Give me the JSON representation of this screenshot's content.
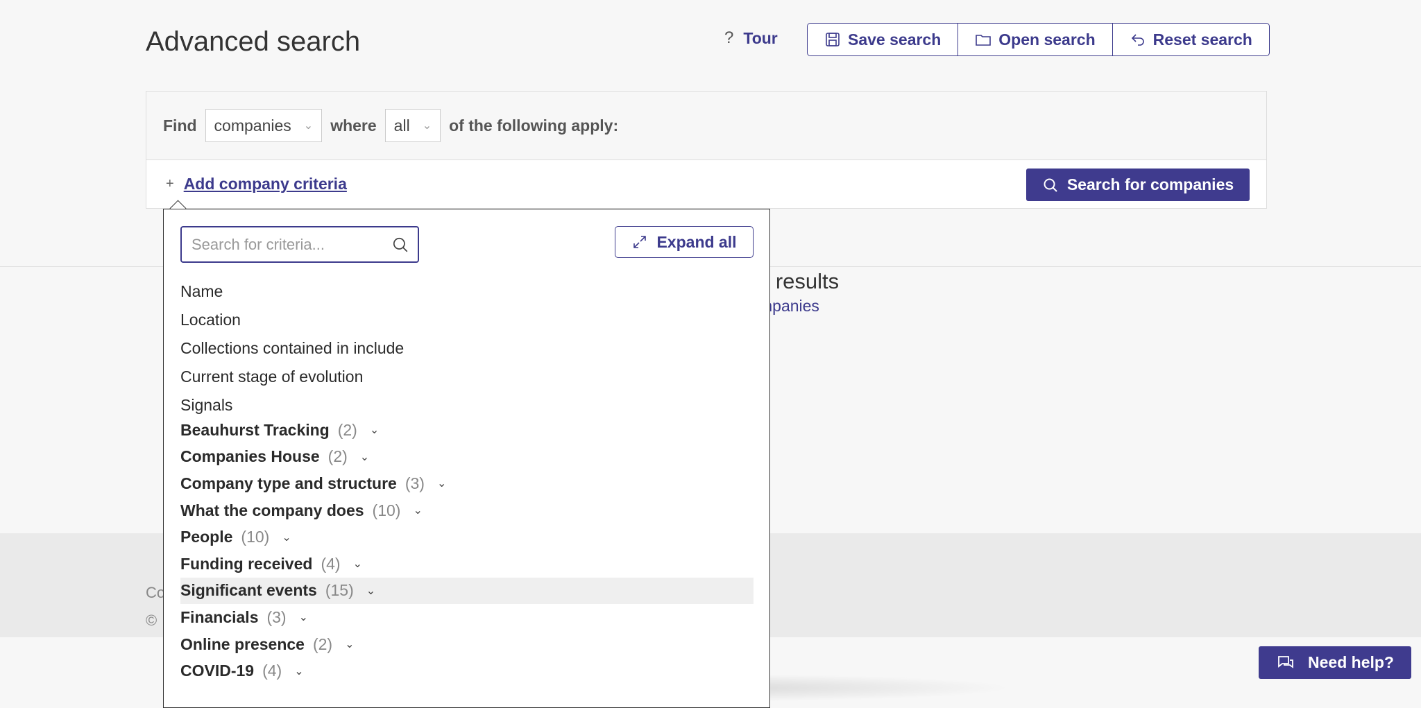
{
  "header": {
    "title": "Advanced search",
    "tour": {
      "icon": "?",
      "label": "Tour"
    },
    "save_label": "Save search",
    "open_label": "Open search",
    "reset_label": "Reset search"
  },
  "criteria_bar": {
    "find_label": "Find",
    "entity_value": "companies",
    "where_label": "where",
    "match_value": "all",
    "apply_label": "of the following apply:",
    "add_icon": "+",
    "add_label": "Add company criteria",
    "search_button": "Search for companies"
  },
  "background": {
    "results_fragment": "e results",
    "link_fragment": "mpanies",
    "footer_line1": "Co",
    "footer_line2": "©"
  },
  "dropdown": {
    "search_placeholder": "Search for criteria...",
    "expand_label": "Expand all",
    "items": [
      {
        "label": "Name"
      },
      {
        "label": "Location"
      },
      {
        "label": "Collections contained in include"
      },
      {
        "label": "Current stage of evolution"
      },
      {
        "label": "Signals"
      }
    ],
    "groups": [
      {
        "label": "Beauhurst Tracking",
        "count": "(2)"
      },
      {
        "label": "Companies House",
        "count": "(2)"
      },
      {
        "label": "Company type and structure",
        "count": "(3)"
      },
      {
        "label": "What the company does",
        "count": "(10)"
      },
      {
        "label": "People",
        "count": "(10)"
      },
      {
        "label": "Funding received",
        "count": "(4)"
      },
      {
        "label": "Significant events",
        "count": "(15)"
      },
      {
        "label": "Financials",
        "count": "(3)"
      },
      {
        "label": "Online presence",
        "count": "(2)"
      },
      {
        "label": "COVID-19",
        "count": "(4)"
      }
    ]
  },
  "help_button": "Need help?",
  "colors": {
    "accent": "#3f3b8e",
    "background": "#f7f7f7",
    "highlight": "#efefef"
  },
  "icons": [
    "question-icon",
    "save-icon",
    "folder-icon",
    "reset-icon",
    "search-icon",
    "expand-icon",
    "chevron-down-icon",
    "chat-icon"
  ]
}
